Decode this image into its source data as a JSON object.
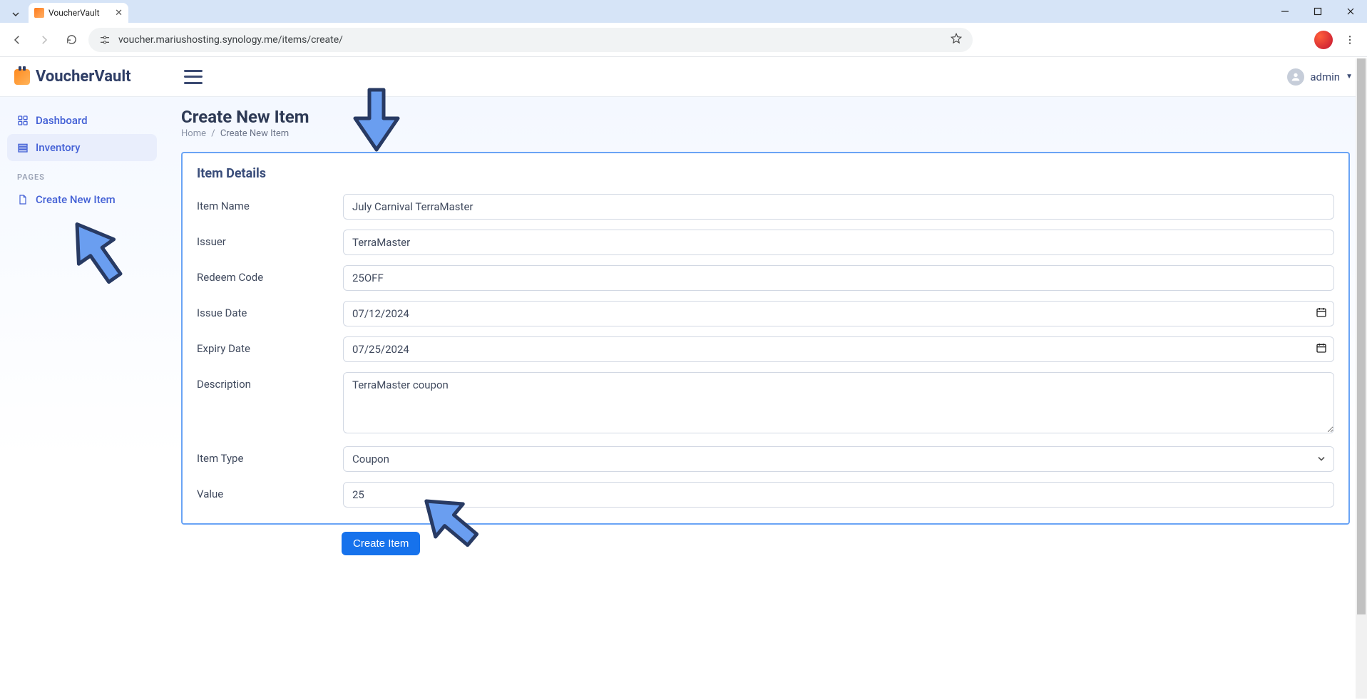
{
  "browser": {
    "tab_title": "VoucherVault",
    "url": "voucher.mariushosting.synology.me/items/create/"
  },
  "brand": {
    "name": "VoucherVault"
  },
  "topbar": {
    "user_label": "admin"
  },
  "sidebar": {
    "items": [
      {
        "label": "Dashboard"
      },
      {
        "label": "Inventory"
      }
    ],
    "section_label": "PAGES",
    "pages": [
      {
        "label": "Create New Item"
      }
    ]
  },
  "page": {
    "title": "Create New Item",
    "breadcrumb_home": "Home",
    "breadcrumb_current": "Create New Item"
  },
  "card": {
    "title": "Item Details"
  },
  "form": {
    "labels": {
      "item_name": "Item Name",
      "issuer": "Issuer",
      "redeem_code": "Redeem Code",
      "issue_date": "Issue Date",
      "expiry_date": "Expiry Date",
      "description": "Description",
      "item_type": "Item Type",
      "value": "Value"
    },
    "values": {
      "item_name": "July Carnival TerraMaster",
      "issuer": "TerraMaster",
      "redeem_code": "25OFF",
      "issue_date": "07/12/2024",
      "expiry_date": "07/25/2024",
      "description": "TerraMaster coupon",
      "item_type": "Coupon",
      "value": "25"
    }
  },
  "buttons": {
    "submit": "Create Item"
  }
}
